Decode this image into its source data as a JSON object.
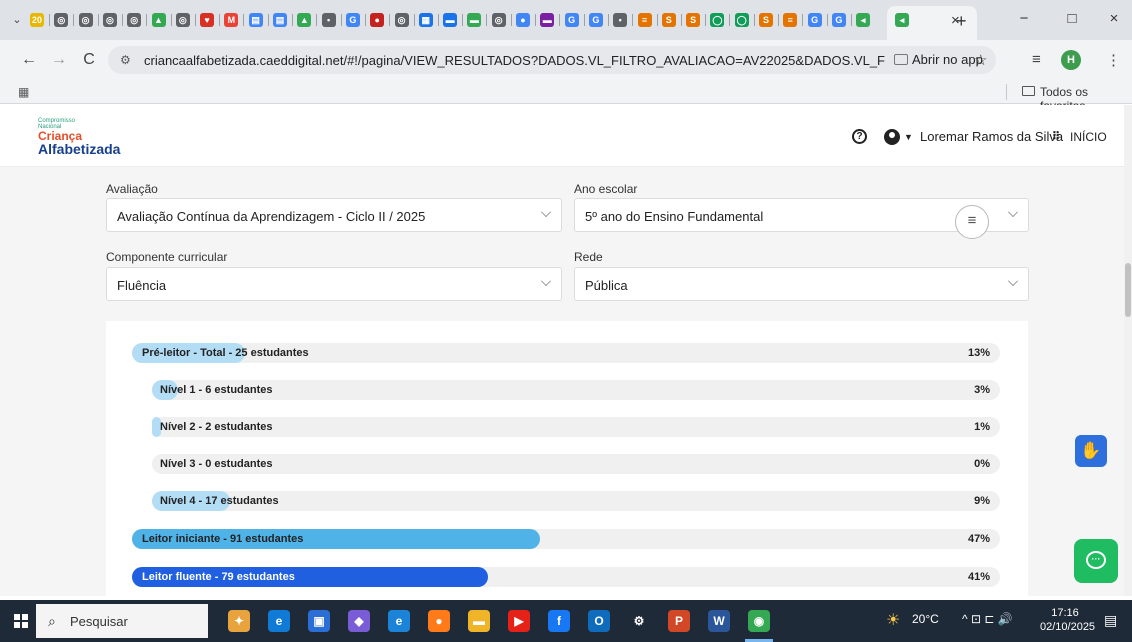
{
  "browser": {
    "tab_favicons": [
      {
        "color": "#e6b800",
        "glyph": "20"
      },
      {
        "color": "#5f6368",
        "glyph": "◎"
      },
      {
        "color": "#5f6368",
        "glyph": "◎"
      },
      {
        "color": "#5f6368",
        "glyph": "◎"
      },
      {
        "color": "#5f6368",
        "glyph": "◎"
      },
      {
        "color": "#34a853",
        "glyph": "▲"
      },
      {
        "color": "#5f6368",
        "glyph": "◎"
      },
      {
        "color": "#d93025",
        "glyph": "♥"
      },
      {
        "color": "#ea4335",
        "glyph": "M"
      },
      {
        "color": "#4285f4",
        "glyph": "▤"
      },
      {
        "color": "#4285f4",
        "glyph": "▤"
      },
      {
        "color": "#34a853",
        "glyph": "▲"
      },
      {
        "color": "#5f6368",
        "glyph": "•"
      },
      {
        "color": "#4285f4",
        "glyph": "G"
      },
      {
        "color": "#c5221f",
        "glyph": "●"
      },
      {
        "color": "#5f6368",
        "glyph": "◎"
      },
      {
        "color": "#1a73e8",
        "glyph": "▦"
      },
      {
        "color": "#1a73e8",
        "glyph": "▬"
      },
      {
        "color": "#34a853",
        "glyph": "▬"
      },
      {
        "color": "#5f6368",
        "glyph": "◎"
      },
      {
        "color": "#4285f4",
        "glyph": "●"
      },
      {
        "color": "#7b1fa2",
        "glyph": "▬"
      },
      {
        "color": "#4285f4",
        "glyph": "G"
      },
      {
        "color": "#4285f4",
        "glyph": "G"
      },
      {
        "color": "#5f6368",
        "glyph": "•"
      },
      {
        "color": "#e37400",
        "glyph": "≡"
      },
      {
        "color": "#e37400",
        "glyph": "S"
      },
      {
        "color": "#e37400",
        "glyph": "S"
      },
      {
        "color": "#0f9d58",
        "glyph": "◯"
      },
      {
        "color": "#0f9d58",
        "glyph": "◯"
      },
      {
        "color": "#e37400",
        "glyph": "S"
      },
      {
        "color": "#e37400",
        "glyph": "≡"
      },
      {
        "color": "#4285f4",
        "glyph": "G"
      },
      {
        "color": "#4285f4",
        "glyph": "G"
      },
      {
        "color": "#34a853",
        "glyph": "◂"
      }
    ],
    "active_tab_close": "×",
    "new_tab": "+",
    "window_controls": {
      "minimize": "−",
      "maximize": "□",
      "close": "×"
    },
    "nav": {
      "back": "←",
      "forward": "→",
      "reload": "C"
    },
    "url": "criancaalfabetizada.caeddigital.net/#!/pagina/VIEW_RESULTADOS?DADOS.VL_FILTRO_AVALIACAO=AV22025&DADOS.VL_FILTRO_ETAPA=ENSINO...",
    "open_in_app": "Abrir no app",
    "profile_initial": "H",
    "bookmarks_all": "Todos os favoritos"
  },
  "header": {
    "logo": {
      "line1": "Compromisso",
      "line2": "Nacional",
      "line3": "Criança",
      "line4": "Alfabetizada"
    },
    "help": "?",
    "user_name": "Loremar Ramos da Silva",
    "home_label": "INÍCIO"
  },
  "filters": {
    "avaliacao": {
      "label": "Avaliação",
      "value": "Avaliação Contínua da Aprendizagem - Ciclo II / 2025"
    },
    "ano_escolar": {
      "label": "Ano escolar",
      "value": "5º ano do Ensino Fundamental"
    },
    "componente": {
      "label": "Componente curricular",
      "value": "Fluência"
    },
    "rede": {
      "label": "Rede",
      "value": "Pública"
    }
  },
  "results": [
    {
      "label": "Pré-leitor - Total - 25 estudantes",
      "percent": 13,
      "percent_label": "13%",
      "color": "#b3dcf5",
      "indent": false
    },
    {
      "label": "Nível 1 - 6 estudantes",
      "percent": 3,
      "percent_label": "3%",
      "color": "#b3dcf5",
      "indent": true
    },
    {
      "label": "Nível 2 - 2 estudantes",
      "percent": 1,
      "percent_label": "1%",
      "color": "#b3dcf5",
      "indent": true
    },
    {
      "label": "Nível 3 - 0 estudantes",
      "percent": 0,
      "percent_label": "0%",
      "color": "#b3dcf5",
      "indent": true
    },
    {
      "label": "Nível 4 - 17 estudantes",
      "percent": 9,
      "percent_label": "9%",
      "color": "#b3dcf5",
      "indent": true
    },
    {
      "label": "Leitor iniciante - 91 estudantes",
      "percent": 47,
      "percent_label": "47%",
      "color": "#4fb3e8",
      "indent": false
    },
    {
      "label": "Leitor fluente - 79 estudantes",
      "percent": 41,
      "percent_label": "41%",
      "color": "#1f5fe0",
      "indent": false
    }
  ],
  "taskbar": {
    "search_placeholder": "Pesquisar",
    "apps": [
      {
        "name": "copilot",
        "color": "#e8a33c",
        "glyph": "✦"
      },
      {
        "name": "edge",
        "color": "#0f7bd6",
        "glyph": "e"
      },
      {
        "name": "store",
        "color": "#2b6fd6",
        "glyph": "▣"
      },
      {
        "name": "copilot-app",
        "color": "#7a5cd6",
        "glyph": "◆"
      },
      {
        "name": "ie",
        "color": "#1c84d8",
        "glyph": "e"
      },
      {
        "name": "firefox",
        "color": "#ff7a18",
        "glyph": "●"
      },
      {
        "name": "files",
        "color": "#f0b429",
        "glyph": "▬"
      },
      {
        "name": "youtube",
        "color": "#e62117",
        "glyph": "▶"
      },
      {
        "name": "facebook",
        "color": "#1877f2",
        "glyph": "f"
      },
      {
        "name": "outlook",
        "color": "#0f6cbd",
        "glyph": "O"
      },
      {
        "name": "settings",
        "color": "#1f2a38",
        "glyph": "⚙"
      },
      {
        "name": "powerpoint",
        "color": "#d24726",
        "glyph": "P"
      },
      {
        "name": "word",
        "color": "#2b579a",
        "glyph": "W"
      },
      {
        "name": "chrome",
        "color": "#34a853",
        "glyph": "◉"
      }
    ],
    "weather": "20°C",
    "tray": "^ ⊡ ⊏ 🔊",
    "time": "17:16",
    "date": "02/10/2025"
  }
}
